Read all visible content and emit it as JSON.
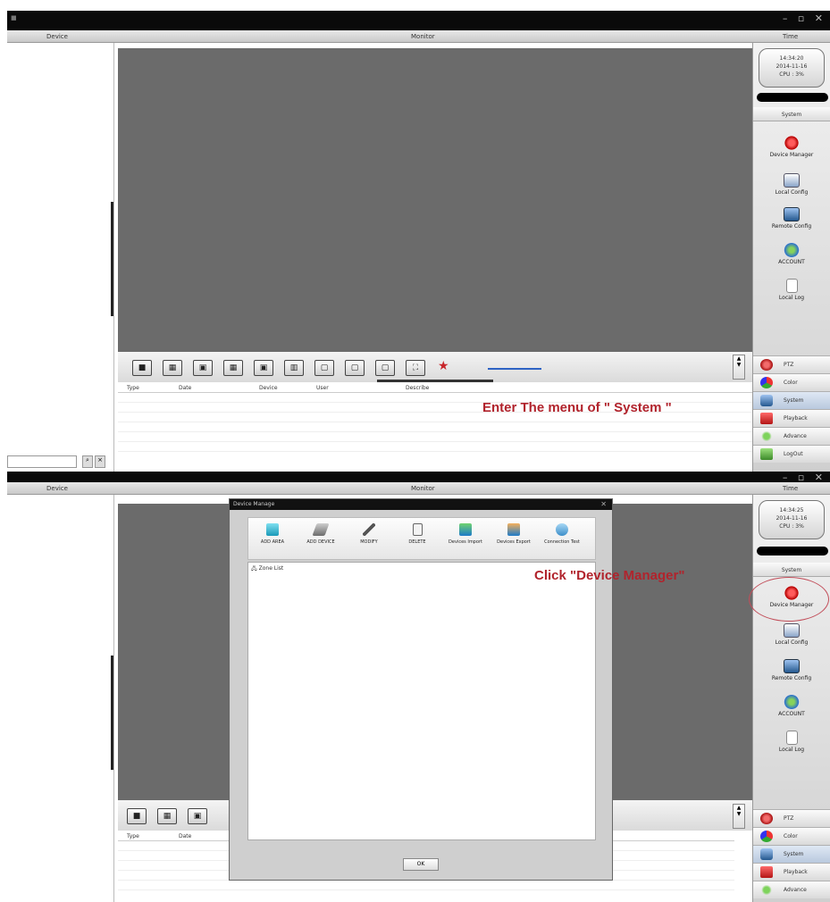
{
  "panel1": {
    "header": {
      "device": "Device",
      "monitor": "Monitor",
      "time": "Time"
    },
    "clock": {
      "time": "14:34:20",
      "date": "2014-11-16",
      "cpu": "CPU : 3%"
    },
    "system": {
      "header": "System",
      "items": [
        "Device Manager",
        "Local Config",
        "Remote Config",
        "ACCOUNT",
        "Local Log"
      ]
    },
    "nav": [
      "PTZ",
      "Color",
      "System",
      "Playback",
      "Advance",
      "LogOut"
    ],
    "log_columns": [
      "Type",
      "Date",
      "Device",
      "User",
      "Describe"
    ],
    "annotation": "Enter The menu of \" System \""
  },
  "panel2": {
    "header": {
      "device": "Device",
      "monitor": "Monitor",
      "time": "Time"
    },
    "clock": {
      "time": "14:34:25",
      "date": "2014-11-16",
      "cpu": "CPU : 3%"
    },
    "system": {
      "header": "System",
      "items": [
        "Device Manager",
        "Local Config",
        "Remote Config",
        "ACCOUNT",
        "Local Log"
      ]
    },
    "nav": [
      "PTZ",
      "Color",
      "System",
      "Playback",
      "Advance"
    ],
    "log_columns": [
      "Type",
      "Date"
    ],
    "annotation": "Click \"Device Manager\"",
    "dialog": {
      "title": "Device Manage",
      "tools": [
        "ADD AREA",
        "ADD DEVICE",
        "MODIFY",
        "DELETE",
        "Devices Import",
        "Devices Export",
        "Connection Test"
      ],
      "tree_root": "Zone List",
      "ok": "OK"
    }
  },
  "colors": {
    "annotation": "#b1232c",
    "video_bg": "#6b6b6b",
    "titlebar": "#0a0a0a"
  }
}
